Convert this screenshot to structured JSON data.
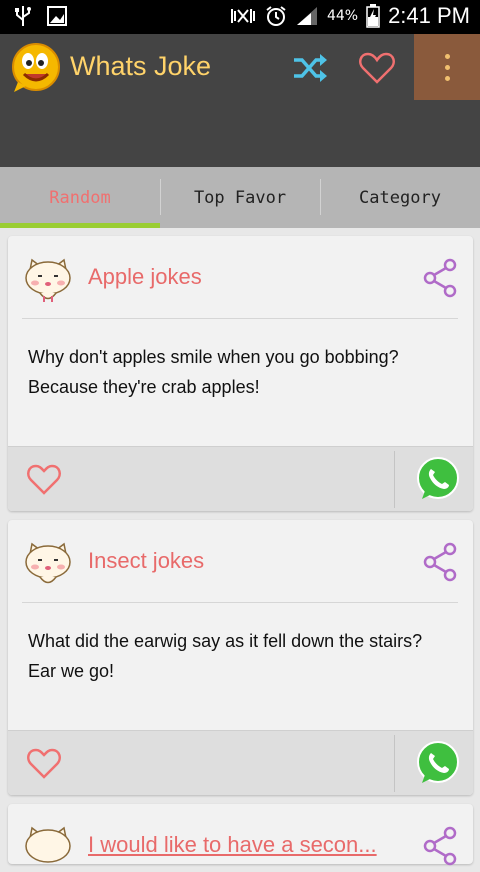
{
  "status_bar": {
    "battery": "44%",
    "time": "2:41 PM"
  },
  "app": {
    "title": "Whats Joke"
  },
  "tabs": [
    {
      "label": "Random",
      "active": true
    },
    {
      "label": "Top Favor",
      "active": false
    },
    {
      "label": "Category",
      "active": false
    }
  ],
  "cards": [
    {
      "title": "Apple jokes",
      "text": "Why don't apples smile when you go bobbing?Because they're crab apples!"
    },
    {
      "title": "Insect jokes",
      "text": "What did the earwig say as it fell down the stairs?Ear we go!"
    },
    {
      "title": "I would like to have a secon..."
    }
  ],
  "colors": {
    "accent": "#e86a6a",
    "title": "#ffd36a",
    "indicator": "#9acd32",
    "overflow": "#8a5a3c"
  },
  "icons": [
    "usb-icon",
    "image-icon",
    "mute-icon",
    "alarm-icon",
    "signal-icon",
    "battery-icon",
    "shuffle-icon",
    "heart-icon",
    "more-vert-icon",
    "share-icon",
    "whatsapp-icon"
  ]
}
